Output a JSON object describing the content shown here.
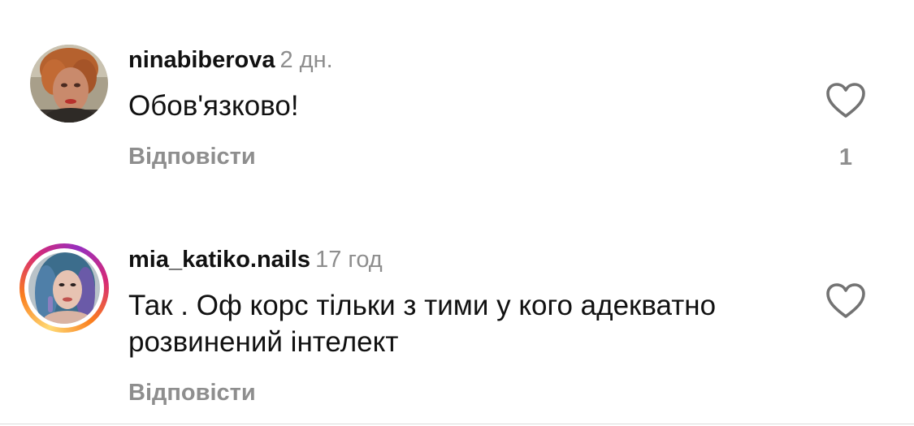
{
  "comments": [
    {
      "username": "ninabiberova",
      "time": "2 дн.",
      "text": "Обов'язково!",
      "reply_label": "Відповісти",
      "like_count": "1",
      "icon": "heart-outline-icon",
      "has_story_ring": false
    },
    {
      "username": "mia_katiko.nails",
      "time": "17 год",
      "text": "Так . Оф корс тільки з тими у кого адекватно розвинений інтелект",
      "reply_label": "Відповісти",
      "icon": "heart-outline-icon",
      "has_story_ring": true
    }
  ],
  "colors": {
    "text": "#111111",
    "secondary": "#8e8e8e",
    "story_ring": [
      "#feda75",
      "#fa7e1e",
      "#d62976",
      "#962fbf"
    ]
  }
}
